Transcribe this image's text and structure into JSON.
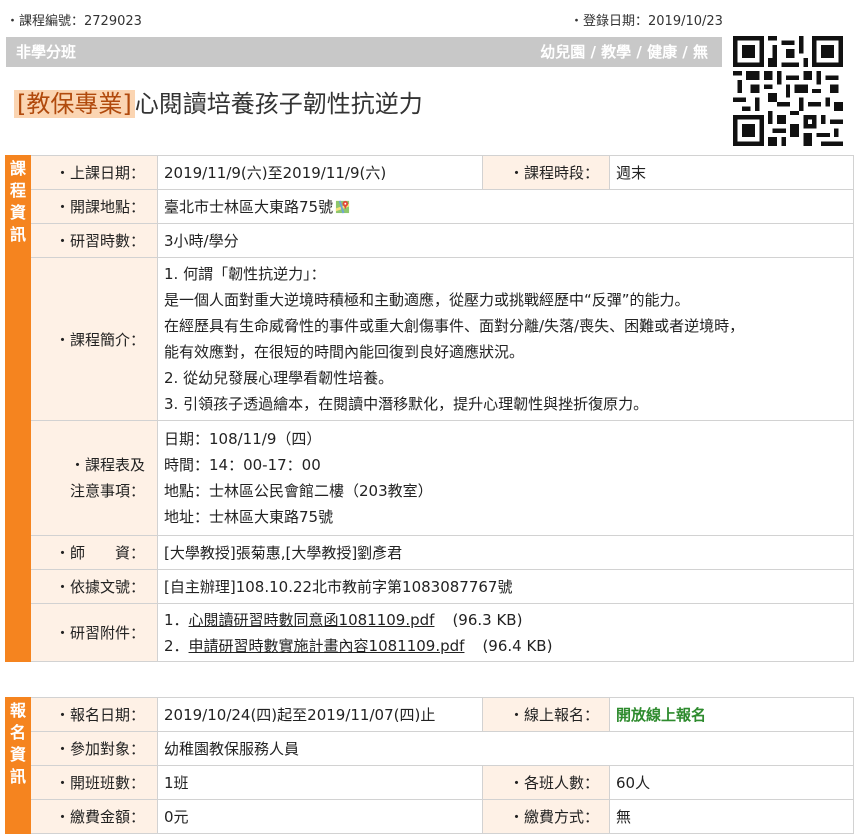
{
  "header": {
    "course_no": "・課程編號：2729023",
    "register_date": "・登錄日期：2019/10/23",
    "category_left": "非學分班",
    "category_right": "幼兒園 / 教學 / 健康 / 無",
    "title_tag": "[教保專業]",
    "title": "心閱讀培養孩子韌性抗逆力"
  },
  "course_info": {
    "side_label": [
      "課",
      "程",
      "資",
      "訊"
    ],
    "date_label": "・上課日期：",
    "date_value": "2019/11/9(六)至2019/11/9(六)",
    "period_label": "・課程時段：",
    "period_value": "週末",
    "location_label": "・開課地點：",
    "location_value": "臺北市士林區大東路75號",
    "hours_label": "・研習時數：",
    "hours_value": "3小時/學分",
    "intro_label": "・課程簡介：",
    "intro_lines": [
      "1. 何謂「韌性抗逆力」：",
      "是一個人面對重大逆境時積極和主動適應，從壓力或挑戰經歷中“反彈”的能力。",
      "在經歷具有生命威脅性的事件或重大創傷事件、面對分離/失落/喪失、困難或者逆境時，",
      "能有效應對，在很短的時間內能回復到良好適應狀況。",
      "2. 從幼兒發展心理學看韌性培養。",
      "3. 引領孩子透過繪本，在閱讀中潛移默化，提升心理韌性與挫折復原力。"
    ],
    "schedule_label_1": "・課程表及",
    "schedule_label_2": "注意事項：",
    "schedule_lines": [
      "日期：108/11/9（四）",
      "時間：14：00-17：00",
      "地點：士林區公民會館二樓（203教室）",
      "地址：士林區大東路75號"
    ],
    "teacher_label": "・師　　資：",
    "teacher_value": "[大學教授]張菊惠,[大學教授]劉彥君",
    "basis_label": "・依據文號：",
    "basis_value": "[自主辦理]108.10.22北市教前字第1083087767號",
    "attach_label": "・研習附件：",
    "attachments": [
      {
        "prefix": "1．",
        "name": "心閱讀研習時數同意函1081109.pdf",
        "size": "(96.3 KB)"
      },
      {
        "prefix": "2．",
        "name": "申請研習時數實施計畫內容1081109.pdf",
        "size": "(96.4 KB)"
      }
    ]
  },
  "registration": {
    "side_label": [
      "報",
      "名",
      "資",
      "訊"
    ],
    "reg_date_label": "・報名日期：",
    "reg_date_value": "2019/10/24(四)起至2019/11/07(四)止",
    "online_label": "・線上報名：",
    "online_value": "開放線上報名",
    "target_label": "・參加對象：",
    "target_value": "幼稚園教保服務人員",
    "classes_label": "・開班班數：",
    "classes_value": "1班",
    "per_class_label": "・各班人數：",
    "per_class_value": "60人",
    "fee_label": "・繳費金額：",
    "fee_value": "0元",
    "pay_label": "・繳費方式：",
    "pay_value": "無"
  },
  "colors": {
    "accent": "#f5841f",
    "label_bg": "#fef1e6",
    "bar": "#c8c8c8",
    "tag_bg": "#fbd5b2",
    "green": "#2e8b2e"
  }
}
